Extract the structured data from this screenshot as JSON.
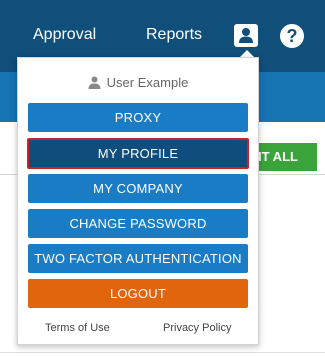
{
  "nav": {
    "approval": "Approval",
    "reports": "Reports",
    "profile_icon": "user-icon",
    "help_icon": "question-mark-icon",
    "help_glyph": "?"
  },
  "background": {
    "submit_all_label": "IT ALL"
  },
  "dropdown": {
    "user_name": "User Example",
    "items": [
      {
        "label": "PROXY"
      },
      {
        "label": "MY PROFILE",
        "active": true
      },
      {
        "label": "MY COMPANY"
      },
      {
        "label": "CHANGE PASSWORD"
      },
      {
        "label": "TWO FACTOR AUTHENTICATION"
      },
      {
        "label": "LOGOUT"
      }
    ],
    "footer": {
      "terms": "Terms of Use",
      "privacy": "Privacy Policy"
    }
  },
  "colors": {
    "topbar": "#0f4f7a",
    "subbar": "#1674b2",
    "menu_button": "#1a7cc4",
    "active_button": "#0e4d7e",
    "active_border": "#c8232c",
    "logout": "#e0650d",
    "submit": "#3aa33a"
  }
}
